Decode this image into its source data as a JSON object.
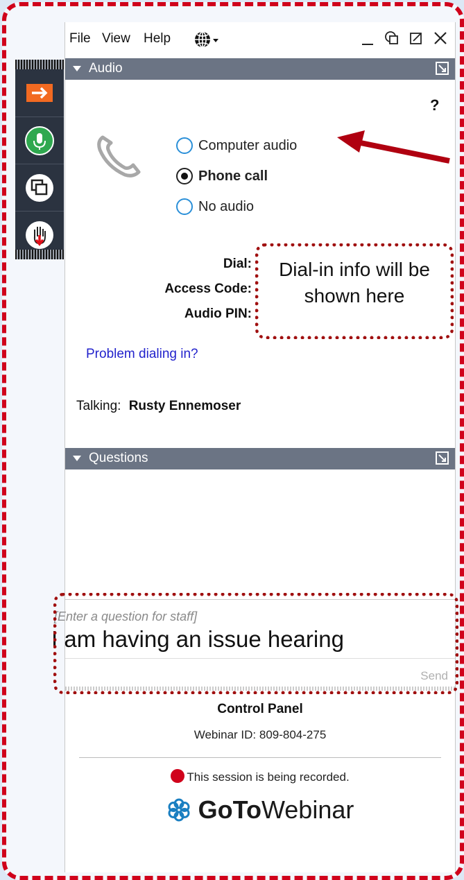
{
  "menu": {
    "file": "File",
    "view": "View",
    "help": "Help"
  },
  "audio": {
    "header": "Audio",
    "help_mark": "?",
    "options": [
      "Computer audio",
      "Phone call",
      "No audio"
    ],
    "selected": "Phone call",
    "dial_label": "Dial:",
    "access_code_label": "Access Code:",
    "audio_pin_label": "Audio PIN:",
    "problem_link": "Problem dialing in?",
    "talking_label": "Talking:",
    "talking_name": "Rusty Ennemoser"
  },
  "callouts": {
    "dialin": "Dial-in info will be shown here"
  },
  "questions": {
    "header": "Questions",
    "placeholder": "[Enter a question for staff]",
    "value": "I am having an issue hearing",
    "send_label": "Send"
  },
  "footer": {
    "title": "Control Panel",
    "webinar_id": "Webinar ID: 809-804-275",
    "recording": "This session is being recorded.",
    "brand_bold": "GoTo",
    "brand_light": "Webinar"
  },
  "colors": {
    "accent_red": "#d0021b",
    "mic_green": "#2fa84f",
    "orange": "#f26a21",
    "header_gray": "#6b7484",
    "link_blue": "#2222cc"
  }
}
